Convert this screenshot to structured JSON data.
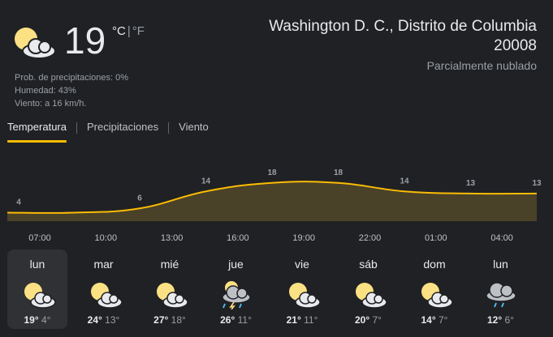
{
  "current": {
    "icon": "partly-cloudy-icon",
    "temperature": "19",
    "unit_c": "°C",
    "unit_sep": "|",
    "unit_f": "°F",
    "details": {
      "precipitation": "Prob. de precipitaciones: 0%",
      "humidity": "Humedad: 43%",
      "wind": "Viento: a 16 km/h."
    },
    "location": "Washington D. C., Distrito de Columbia 20008",
    "condition": "Parcialmente nublado"
  },
  "tabs": [
    {
      "label": "Temperatura",
      "active": true
    },
    {
      "label": "Precipitaciones",
      "active": false
    },
    {
      "label": "Viento",
      "active": false
    }
  ],
  "colors": {
    "accent": "#fbbc04",
    "fill": "#4a4129",
    "sun": "#fbe183",
    "cloud": "#e8eaed"
  },
  "chart_data": {
    "type": "area",
    "x": [
      "04:00",
      "07:00",
      "10:00",
      "13:00",
      "16:00",
      "19:00",
      "22:00",
      "01:00",
      "04:00"
    ],
    "y": [
      4,
      4,
      6,
      14,
      18,
      18,
      14,
      13,
      13
    ],
    "data_labels": [
      "4",
      "",
      "6",
      "14",
      "18",
      "18",
      "14",
      "13",
      "13"
    ],
    "tick_labels": [
      "07:00",
      "10:00",
      "13:00",
      "16:00",
      "19:00",
      "22:00",
      "01:00",
      "04:00"
    ],
    "ylim": [
      0,
      22
    ]
  },
  "days": [
    {
      "name": "lun",
      "hi": "19°",
      "lo": "4°",
      "icon": "partly-cloudy-icon",
      "active": true
    },
    {
      "name": "mar",
      "hi": "24°",
      "lo": "13°",
      "icon": "partly-cloudy-icon",
      "active": false
    },
    {
      "name": "mié",
      "hi": "27°",
      "lo": "18°",
      "icon": "partly-cloudy-icon",
      "active": false
    },
    {
      "name": "jue",
      "hi": "26°",
      "lo": "11°",
      "icon": "thunderstorm-icon",
      "active": false
    },
    {
      "name": "vie",
      "hi": "21°",
      "lo": "11°",
      "icon": "partly-cloudy-icon",
      "active": false
    },
    {
      "name": "sáb",
      "hi": "20°",
      "lo": "7°",
      "icon": "partly-cloudy-icon",
      "active": false
    },
    {
      "name": "dom",
      "hi": "14°",
      "lo": "7°",
      "icon": "partly-cloudy-icon",
      "active": false
    },
    {
      "name": "lun",
      "hi": "12°",
      "lo": "6°",
      "icon": "rain-icon",
      "active": false
    }
  ]
}
